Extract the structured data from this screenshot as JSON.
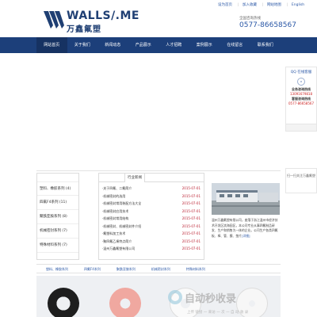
{
  "header": {
    "logo_en": "WALLS/.ME",
    "logo_cn": "万鑫氟塑",
    "top_links": [
      "设为首页",
      "加入收藏",
      "网站地图",
      "English"
    ],
    "hotline_label": "全国咨询热线",
    "hotline": "0577-86658567"
  },
  "nav": {
    "items": [
      "网站首页",
      "关于我们",
      "新闻动态",
      "产品展示",
      "人才招聘",
      "案例展示",
      "在线留言",
      "联系我们"
    ]
  },
  "qq_panel": {
    "title": "QQ 在线客服",
    "rows": [
      "业务咨询热线",
      "13091679818",
      "客服咨询热线",
      "0577-86658567"
    ]
  },
  "scan_panel": {
    "text": "扫一扫关注万鑫氟塑"
  },
  "categories": {
    "items": [
      "塑料、橡胶系列 (4)",
      "四氟F4系列 (11)",
      "聚酰亚胺系列 (8)",
      "机械密封系列 (7)",
      "特殊材料系列 (7)"
    ]
  },
  "news": {
    "tab_label": "行业新闻",
    "rows": [
      {
        "title": "·关于四氟、二氟简介",
        "date": "2015-07-01"
      },
      {
        "title": "·机械密封的选用",
        "date": "2015-07-01"
      },
      {
        "title": "·机械密封常用装配方法大全",
        "date": "2015-07-01"
      },
      {
        "title": "·机械密封应用技术",
        "date": "2015-07-01"
      },
      {
        "title": "·机械密封常用结构",
        "date": "2015-07-01"
      },
      {
        "title": "·机械密封、机械密封件介绍",
        "date": "2015-07-01"
      },
      {
        "title": "·氟塑料加工技术",
        "date": "2015-07-01"
      },
      {
        "title": "·聚四氟乙烯特点简介",
        "date": "2015-07-01"
      },
      {
        "title": "·温州万鑫氟塑有限公司",
        "date": "2015-07-01"
      }
    ]
  },
  "about": {
    "text": "温州万鑫氟塑有限公司，座落于浙江温州市经济技术开发区滨海园区，本公司专业从事四氟制品研发、生产和销售为一体的企业。公司生产各类四氟板、棒、管、膜、垫片",
    "more": "[详细]"
  },
  "product_tabs": [
    "塑料、橡胶系列",
    "四氟F4系列",
    "聚酰亚胺系列",
    "机械密封系列",
    "特殊材料系列"
  ],
  "watermark": {
    "text": "自动秒收录",
    "subtitle": "上传 链接 一 来访 一 次 一 自 动 收 录"
  },
  "colors": {
    "nav_bg": "#1c3f7a",
    "brand": "#1f3f73",
    "link": "#2a57a6",
    "date": "#b22233"
  }
}
